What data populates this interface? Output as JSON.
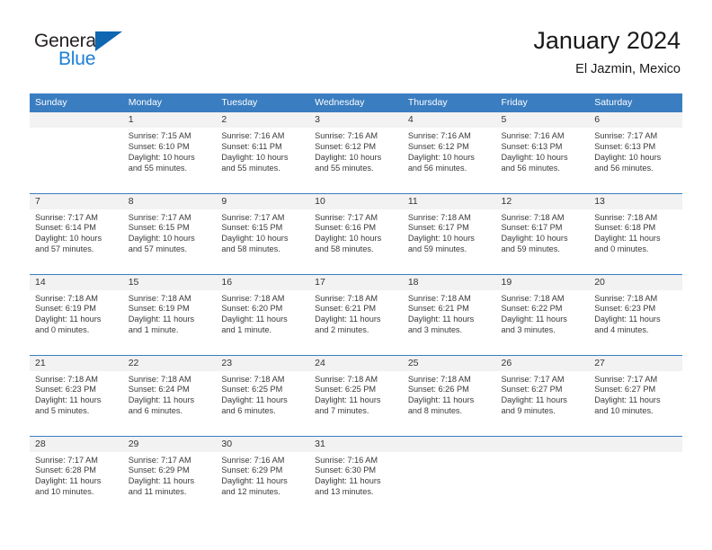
{
  "brand": {
    "word_one": "General",
    "word_two": "Blue",
    "flag_icon": "triangle-flag-icon",
    "colors": {
      "general": "#231f20",
      "blue": "#1c7fd6",
      "flag": "#0f67b1"
    }
  },
  "header": {
    "title": "January 2024",
    "subtitle": "El Jazmin, Mexico"
  },
  "theme": {
    "header_blue": "#3a7dc0",
    "daynum_gray": "#f2f2f2",
    "cell_white": "#ffffff",
    "text": "#3a3a3a"
  },
  "calendar": {
    "weekday_headers": [
      "Sunday",
      "Monday",
      "Tuesday",
      "Wednesday",
      "Thursday",
      "Friday",
      "Saturday"
    ],
    "weeks": [
      [
        {
          "day": "",
          "lines": []
        },
        {
          "day": "1",
          "lines": [
            "Sunrise: 7:15 AM",
            "Sunset: 6:10 PM",
            "Daylight: 10 hours",
            "and 55 minutes."
          ]
        },
        {
          "day": "2",
          "lines": [
            "Sunrise: 7:16 AM",
            "Sunset: 6:11 PM",
            "Daylight: 10 hours",
            "and 55 minutes."
          ]
        },
        {
          "day": "3",
          "lines": [
            "Sunrise: 7:16 AM",
            "Sunset: 6:12 PM",
            "Daylight: 10 hours",
            "and 55 minutes."
          ]
        },
        {
          "day": "4",
          "lines": [
            "Sunrise: 7:16 AM",
            "Sunset: 6:12 PM",
            "Daylight: 10 hours",
            "and 56 minutes."
          ]
        },
        {
          "day": "5",
          "lines": [
            "Sunrise: 7:16 AM",
            "Sunset: 6:13 PM",
            "Daylight: 10 hours",
            "and 56 minutes."
          ]
        },
        {
          "day": "6",
          "lines": [
            "Sunrise: 7:17 AM",
            "Sunset: 6:13 PM",
            "Daylight: 10 hours",
            "and 56 minutes."
          ]
        }
      ],
      [
        {
          "day": "7",
          "lines": [
            "Sunrise: 7:17 AM",
            "Sunset: 6:14 PM",
            "Daylight: 10 hours",
            "and 57 minutes."
          ]
        },
        {
          "day": "8",
          "lines": [
            "Sunrise: 7:17 AM",
            "Sunset: 6:15 PM",
            "Daylight: 10 hours",
            "and 57 minutes."
          ]
        },
        {
          "day": "9",
          "lines": [
            "Sunrise: 7:17 AM",
            "Sunset: 6:15 PM",
            "Daylight: 10 hours",
            "and 58 minutes."
          ]
        },
        {
          "day": "10",
          "lines": [
            "Sunrise: 7:17 AM",
            "Sunset: 6:16 PM",
            "Daylight: 10 hours",
            "and 58 minutes."
          ]
        },
        {
          "day": "11",
          "lines": [
            "Sunrise: 7:18 AM",
            "Sunset: 6:17 PM",
            "Daylight: 10 hours",
            "and 59 minutes."
          ]
        },
        {
          "day": "12",
          "lines": [
            "Sunrise: 7:18 AM",
            "Sunset: 6:17 PM",
            "Daylight: 10 hours",
            "and 59 minutes."
          ]
        },
        {
          "day": "13",
          "lines": [
            "Sunrise: 7:18 AM",
            "Sunset: 6:18 PM",
            "Daylight: 11 hours",
            "and 0 minutes."
          ]
        }
      ],
      [
        {
          "day": "14",
          "lines": [
            "Sunrise: 7:18 AM",
            "Sunset: 6:19 PM",
            "Daylight: 11 hours",
            "and 0 minutes."
          ]
        },
        {
          "day": "15",
          "lines": [
            "Sunrise: 7:18 AM",
            "Sunset: 6:19 PM",
            "Daylight: 11 hours",
            "and 1 minute."
          ]
        },
        {
          "day": "16",
          "lines": [
            "Sunrise: 7:18 AM",
            "Sunset: 6:20 PM",
            "Daylight: 11 hours",
            "and 1 minute."
          ]
        },
        {
          "day": "17",
          "lines": [
            "Sunrise: 7:18 AM",
            "Sunset: 6:21 PM",
            "Daylight: 11 hours",
            "and 2 minutes."
          ]
        },
        {
          "day": "18",
          "lines": [
            "Sunrise: 7:18 AM",
            "Sunset: 6:21 PM",
            "Daylight: 11 hours",
            "and 3 minutes."
          ]
        },
        {
          "day": "19",
          "lines": [
            "Sunrise: 7:18 AM",
            "Sunset: 6:22 PM",
            "Daylight: 11 hours",
            "and 3 minutes."
          ]
        },
        {
          "day": "20",
          "lines": [
            "Sunrise: 7:18 AM",
            "Sunset: 6:23 PM",
            "Daylight: 11 hours",
            "and 4 minutes."
          ]
        }
      ],
      [
        {
          "day": "21",
          "lines": [
            "Sunrise: 7:18 AM",
            "Sunset: 6:23 PM",
            "Daylight: 11 hours",
            "and 5 minutes."
          ]
        },
        {
          "day": "22",
          "lines": [
            "Sunrise: 7:18 AM",
            "Sunset: 6:24 PM",
            "Daylight: 11 hours",
            "and 6 minutes."
          ]
        },
        {
          "day": "23",
          "lines": [
            "Sunrise: 7:18 AM",
            "Sunset: 6:25 PM",
            "Daylight: 11 hours",
            "and 6 minutes."
          ]
        },
        {
          "day": "24",
          "lines": [
            "Sunrise: 7:18 AM",
            "Sunset: 6:25 PM",
            "Daylight: 11 hours",
            "and 7 minutes."
          ]
        },
        {
          "day": "25",
          "lines": [
            "Sunrise: 7:18 AM",
            "Sunset: 6:26 PM",
            "Daylight: 11 hours",
            "and 8 minutes."
          ]
        },
        {
          "day": "26",
          "lines": [
            "Sunrise: 7:17 AM",
            "Sunset: 6:27 PM",
            "Daylight: 11 hours",
            "and 9 minutes."
          ]
        },
        {
          "day": "27",
          "lines": [
            "Sunrise: 7:17 AM",
            "Sunset: 6:27 PM",
            "Daylight: 11 hours",
            "and 10 minutes."
          ]
        }
      ],
      [
        {
          "day": "28",
          "lines": [
            "Sunrise: 7:17 AM",
            "Sunset: 6:28 PM",
            "Daylight: 11 hours",
            "and 10 minutes."
          ]
        },
        {
          "day": "29",
          "lines": [
            "Sunrise: 7:17 AM",
            "Sunset: 6:29 PM",
            "Daylight: 11 hours",
            "and 11 minutes."
          ]
        },
        {
          "day": "30",
          "lines": [
            "Sunrise: 7:16 AM",
            "Sunset: 6:29 PM",
            "Daylight: 11 hours",
            "and 12 minutes."
          ]
        },
        {
          "day": "31",
          "lines": [
            "Sunrise: 7:16 AM",
            "Sunset: 6:30 PM",
            "Daylight: 11 hours",
            "and 13 minutes."
          ]
        },
        {
          "day": "",
          "lines": []
        },
        {
          "day": "",
          "lines": []
        },
        {
          "day": "",
          "lines": []
        }
      ]
    ]
  }
}
